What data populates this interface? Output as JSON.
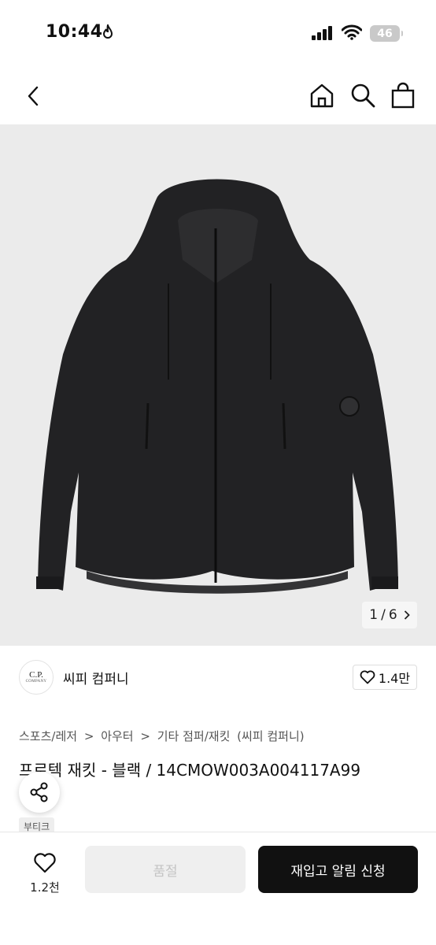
{
  "status_bar": {
    "time": "10:44",
    "battery": "46",
    "icons": [
      "flame-icon",
      "signal-icon",
      "wifi-icon",
      "battery-icon"
    ]
  },
  "nav": {
    "icons": [
      "chevron-left-icon",
      "home-icon",
      "search-icon",
      "shopping-bag-icon"
    ]
  },
  "gallery": {
    "counter_current": "1",
    "counter_total": "6",
    "counter_separator": "/"
  },
  "brand": {
    "logo_text": "C.P.",
    "logo_sub": "COMPANY",
    "name": "씨피 컴퍼니",
    "like_count": "1.4만"
  },
  "breadcrumb": {
    "items": [
      "스포츠/레저",
      "아우터",
      "기타 점퍼/재킷",
      "(씨피 컴퍼니)"
    ]
  },
  "product": {
    "title": "프로텍 재킷 - 블랙 / 14CMOW003A004117A99",
    "badge": "부티크"
  },
  "bottom_bar": {
    "wish_count": "1.2천",
    "soldout_label": "품절",
    "restock_label": "재입고 알림 신청"
  },
  "colors": {
    "accent": "#111111",
    "gallery_bg": "#ebebeb",
    "disabled_bg": "#efefef"
  }
}
